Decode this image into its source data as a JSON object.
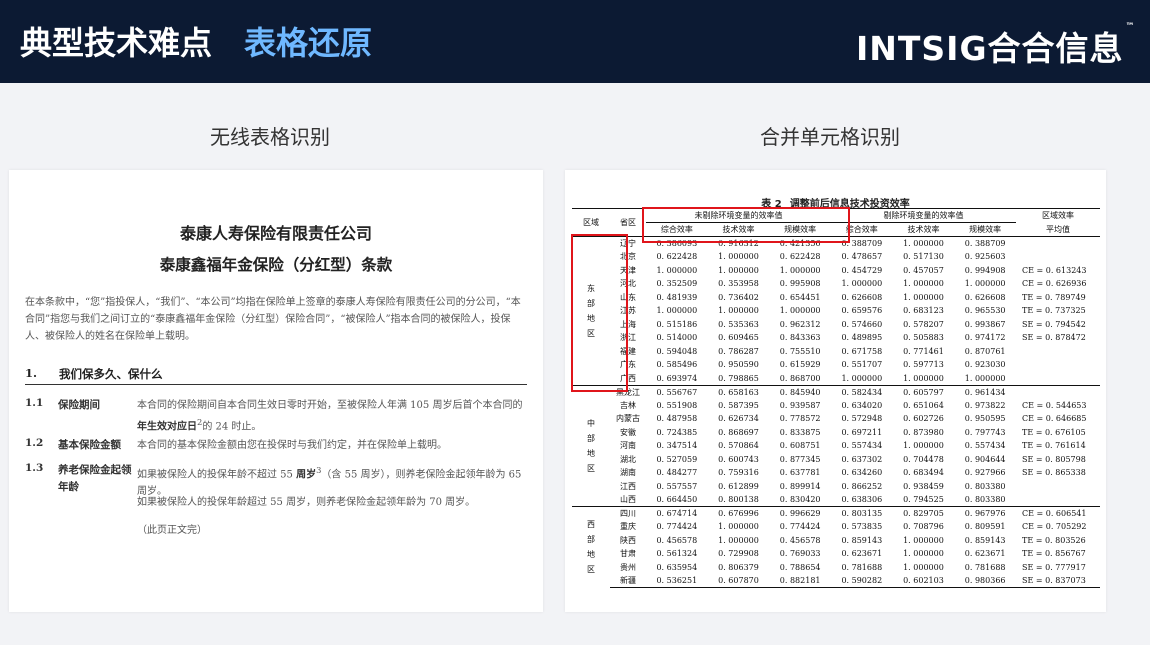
{
  "header": {
    "title_main": "典型技术难点",
    "title_sub": "表格还原",
    "logo_text": "INTSIG合合信息",
    "logo_tm": "™"
  },
  "sections": {
    "left_label": "无线表格识别",
    "right_label": "合并单元格识别"
  },
  "document": {
    "title1": "泰康人寿保险有限责任公司",
    "title2": "泰康鑫福年金保险（分红型）条款",
    "intro": "在本条款中，“您”指投保人，“我们”、“本公司”均指在保险单上签章的泰康人寿保险有限责任公司的分公司，“本合同”指您与我们之间订立的“泰康鑫福年金保险（分红型）保险合同”，“被保险人”指本合同的被保险人，投保人、被保险人的姓名在保险单上载明。",
    "section_num": "1.",
    "section_title": "我们保多久、保什么",
    "clauses": [
      {
        "num": "1.1",
        "title": "保险期间",
        "body_a": "本合同的保险期间自本合同生效日零时开始，至被保险人年满 105 周岁后首个本合同的",
        "body_bold": "年生效对应日",
        "body_sup": "2",
        "body_b": "的 24 时止。"
      },
      {
        "num": "1.2",
        "title": "基本保险金额",
        "body_a": "本合同的基本保险金额由您在投保时与我们约定，并在保险单上载明。"
      },
      {
        "num": "1.3",
        "title": "养老保险金起领年龄",
        "body_a": "如果被保险人的投保年龄不超过 55 ",
        "body_bold": "周岁",
        "body_sup": "3",
        "body_b": "（含 55 周岁），则养老保险金起领年龄为 65 周岁。",
        "body_c": "如果被保险人的投保年龄超过 55 周岁，则养老保险金起领年龄为 70 周岁。"
      }
    ],
    "end_note": "（此页正文完）"
  },
  "table": {
    "caption_num": "表 2",
    "caption_text": "调整前后信息技术投资效率",
    "h_region": "区域",
    "h_province": "省区",
    "h_group1": "未剔除环境变量的效率值",
    "h_group2": "剔除环境变量的效率值",
    "h_avg1": "区域效率",
    "h_avg2": "平均值",
    "h_sub": [
      "综合效率",
      "技术效率",
      "规模效率",
      "综合效率",
      "技术效率",
      "规模效率"
    ],
    "groups": [
      {
        "region": [
          "东",
          "部",
          "地",
          "区"
        ],
        "rows": [
          [
            "辽宁",
            "0. 386093",
            "0. 916312",
            "0. 421356",
            "0. 388709",
            "1. 000000",
            "0. 388709"
          ],
          [
            "北京",
            "0. 622428",
            "1. 000000",
            "0. 622428",
            "0. 478657",
            "0. 517130",
            "0. 925603"
          ],
          [
            "天津",
            "1. 000000",
            "1. 000000",
            "1. 000000",
            "0. 454729",
            "0. 457057",
            "0. 994908"
          ],
          [
            "河北",
            "0. 352509",
            "0. 353958",
            "0. 995908",
            "1. 000000",
            "1. 000000",
            "1. 000000"
          ],
          [
            "山东",
            "0. 481939",
            "0. 736402",
            "0. 654451",
            "0. 626608",
            "1. 000000",
            "0. 626608"
          ],
          [
            "江苏",
            "1. 000000",
            "1. 000000",
            "1. 000000",
            "0. 659576",
            "0. 683123",
            "0. 965530"
          ],
          [
            "上海",
            "0. 515186",
            "0. 535363",
            "0. 962312",
            "0. 574660",
            "0. 578207",
            "0. 993867"
          ],
          [
            "浙江",
            "0. 514000",
            "0. 609465",
            "0. 843363",
            "0. 489895",
            "0. 505883",
            "0. 974172"
          ],
          [
            "福建",
            "0. 594048",
            "0. 786287",
            "0. 755510",
            "0. 671758",
            "0. 771461",
            "0. 870761"
          ],
          [
            "广东",
            "0. 585496",
            "0. 950590",
            "0. 615929",
            "0. 551707",
            "0. 597713",
            "0. 923030"
          ],
          [
            "广西",
            "0. 693974",
            "0. 798865",
            "0. 868700",
            "1. 000000",
            "1. 000000",
            "1. 000000"
          ]
        ],
        "avg": [
          "",
          "",
          "CE = 0. 613243",
          "CE = 0. 626936",
          "TE = 0. 789749",
          "TE = 0. 737325",
          "SE = 0. 794542",
          "SE = 0. 878472",
          "",
          "",
          ""
        ]
      },
      {
        "region": [
          "中",
          "部",
          "地",
          "区"
        ],
        "rows": [
          [
            "黑龙江",
            "0. 556767",
            "0. 658163",
            "0. 845940",
            "0. 582434",
            "0. 605797",
            "0. 961434"
          ],
          [
            "吉林",
            "0. 551908",
            "0. 587395",
            "0. 939587",
            "0. 634020",
            "0. 651064",
            "0. 973822"
          ],
          [
            "内蒙古",
            "0. 487958",
            "0. 626734",
            "0. 778572",
            "0. 572948",
            "0. 602726",
            "0. 950595"
          ],
          [
            "安徽",
            "0. 724385",
            "0. 868697",
            "0. 833875",
            "0. 697211",
            "0. 873980",
            "0. 797743"
          ],
          [
            "河南",
            "0. 347514",
            "0. 570864",
            "0. 608751",
            "0. 557434",
            "1. 000000",
            "0. 557434"
          ],
          [
            "湖北",
            "0. 527059",
            "0. 600743",
            "0. 877345",
            "0. 637302",
            "0. 704478",
            "0. 904644"
          ],
          [
            "湖南",
            "0. 484277",
            "0. 759316",
            "0. 637781",
            "0. 634260",
            "0. 683494",
            "0. 927966"
          ],
          [
            "江西",
            "0. 557557",
            "0. 612899",
            "0. 899914",
            "0. 866252",
            "0. 938459",
            "0. 803380"
          ],
          [
            "山西",
            "0. 664450",
            "0. 800138",
            "0. 830420",
            "0. 638306",
            "0. 794525",
            "0. 803380"
          ]
        ],
        "avg": [
          "",
          "CE = 0. 544653",
          "CE = 0. 646685",
          "TE = 0. 676105",
          "TE = 0. 761614",
          "SE = 0. 805798",
          "SE = 0. 865338",
          "",
          ""
        ]
      },
      {
        "region": [
          "西",
          "部",
          "地",
          "区"
        ],
        "rows": [
          [
            "四川",
            "0. 674714",
            "0. 676996",
            "0. 996629",
            "0. 803135",
            "0. 829705",
            "0. 967976"
          ],
          [
            "重庆",
            "0. 774424",
            "1. 000000",
            "0. 774424",
            "0. 573835",
            "0. 708796",
            "0. 809591"
          ],
          [
            "陕西",
            "0. 456578",
            "1. 000000",
            "0. 456578",
            "0. 859143",
            "1. 000000",
            "0. 859143"
          ],
          [
            "甘肃",
            "0. 561324",
            "0. 729908",
            "0. 769033",
            "0. 623671",
            "1. 000000",
            "0. 623671"
          ],
          [
            "贵州",
            "0. 635954",
            "0. 806379",
            "0. 788654",
            "0. 781688",
            "1. 000000",
            "0. 781688"
          ],
          [
            "新疆",
            "0. 536251",
            "0. 607870",
            "0. 882181",
            "0. 590282",
            "0. 602103",
            "0. 980366"
          ]
        ],
        "avg": [
          "CE = 0. 606541",
          "CE = 0. 705292",
          "TE = 0. 803526",
          "TE = 0. 856767",
          "SE = 0. 777917",
          "SE = 0. 837073"
        ]
      }
    ]
  }
}
